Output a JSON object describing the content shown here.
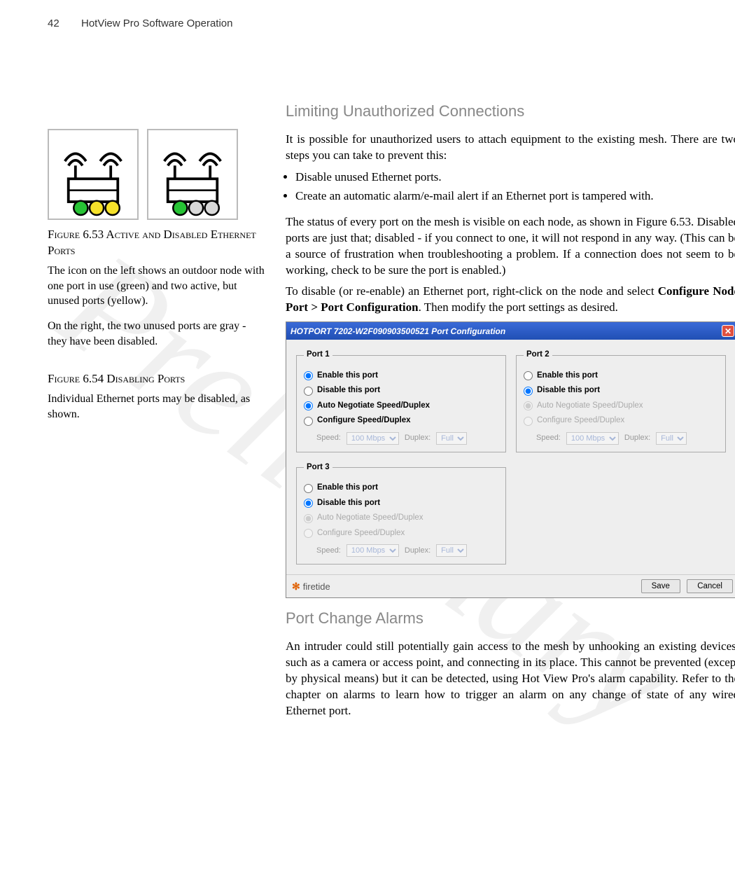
{
  "header": {
    "page_number": "42",
    "running_head": "HotView Pro Software Operation"
  },
  "watermark": "Preliminary",
  "left": {
    "fig53_title": "Figure 6.53 Active and Disabled Ethernet Ports",
    "fig53_cap": "The icon on the left shows an outdoor node with one port in use (green) and two active, but unused ports (yellow).",
    "fig53_cap2": "On the right, the two unused ports are gray - they have been disabled.",
    "fig54_title": "Figure 6.54 Disabling Ports",
    "fig54_cap": "Individual Ethernet ports may be disabled, as shown."
  },
  "right": {
    "h_limiting": "Limiting Unauthorized Connections",
    "p1": "It is possible for unauthorized users to attach equipment to the existing mesh. There are two steps you can take to prevent this:",
    "bullet1": "Disable unused Ethernet ports.",
    "bullet2": "Create an automatic alarm/e-mail alert if an Ethernet port is tampered with.",
    "p2": "The status of every port on the mesh is visible on each node, as shown in Figure 6.53. Disabled ports are just that; disabled - if you connect to one, it will not respond in any way. (This can be a source of frustration when troubleshooting a problem. If a connection does not seem to be working, check to be sure the port is enabled.)",
    "p3a": "To disable (or re-enable) an Ethernet port, right-click on the node and select ",
    "p3b": "Configure Node Port > Port Configuration",
    "p3c": ". Then modify the port settings as desired.",
    "h_alarms": "Port Change Alarms",
    "p4": "An intruder could still potentially gain access to the mesh by unhooking an existing devices, such as a camera or access point, and connecting in its place. This cannot be prevented (except by physical means) but it can be detected, using Hot View Pro's alarm capability. Refer to the chapter on alarms to learn how to trigger an alarm on any change of state of any wired Ethernet port."
  },
  "dialog": {
    "title": "HOTPORT 7202-W2F090903500521 Port Configuration",
    "port1": {
      "legend": "Port 1"
    },
    "port2": {
      "legend": "Port 2"
    },
    "port3": {
      "legend": "Port 3"
    },
    "labels": {
      "enable": "Enable this port",
      "disable": "Disable this port",
      "auto": "Auto Negotiate Speed/Duplex",
      "config": "Configure Speed/Duplex",
      "speed": "Speed:",
      "duplex": "Duplex:",
      "speed_val": "100 Mbps",
      "duplex_val": "Full"
    },
    "brand": "firetide",
    "save": "Save",
    "cancel": "Cancel"
  }
}
